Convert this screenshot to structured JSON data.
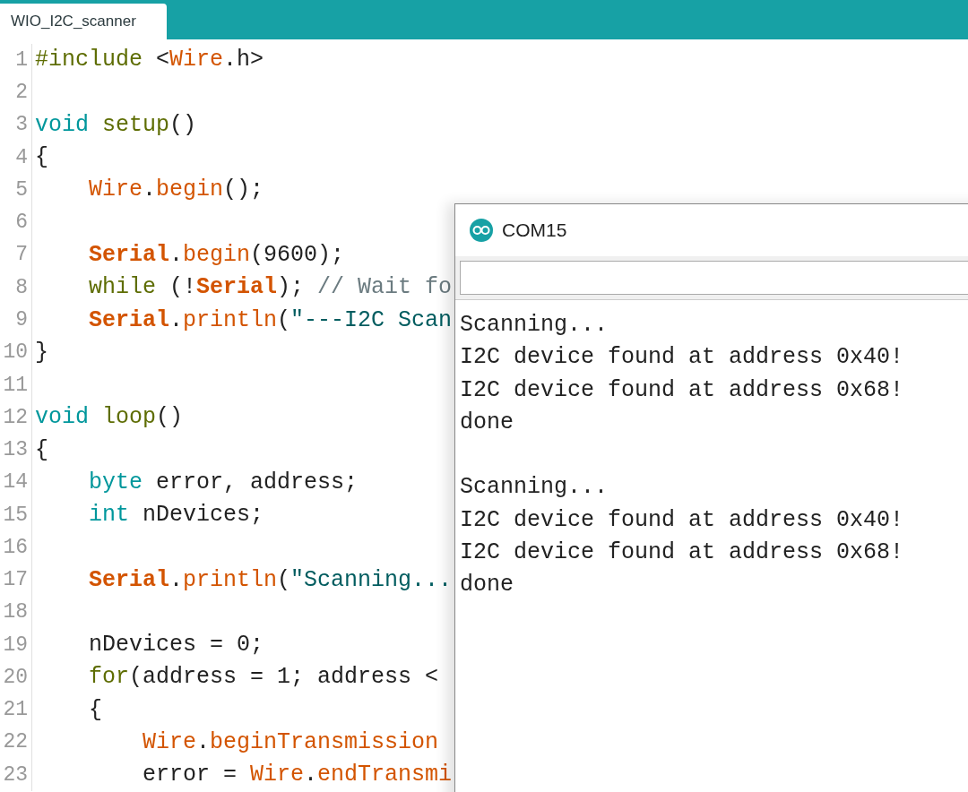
{
  "tabs": [
    {
      "label": "WIO_I2C_scanner",
      "selected": true
    }
  ],
  "editor": {
    "lines": [
      {
        "number": "1",
        "tokens": [
          {
            "text": "#include",
            "kind": "function"
          },
          {
            "text": " <",
            "kind": "plain"
          },
          {
            "text": "Wire",
            "kind": "method"
          },
          {
            "text": ".h>",
            "kind": "plain"
          }
        ]
      },
      {
        "number": "2"
      },
      {
        "number": "3",
        "tokens": [
          {
            "text": "void",
            "kind": "keyword"
          },
          {
            "text": " setup",
            "kind": "function"
          },
          {
            "text": "()",
            "kind": "plain"
          }
        ]
      },
      {
        "number": "4",
        "tokens": [
          {
            "text": "{",
            "kind": "plain"
          }
        ]
      },
      {
        "number": "5",
        "tokens": [
          {
            "text": "    Wire",
            "kind": "method"
          },
          {
            "text": ".",
            "kind": "plain"
          },
          {
            "text": "begin",
            "kind": "method"
          },
          {
            "text": "();",
            "kind": "plain"
          }
        ]
      },
      {
        "number": "6"
      },
      {
        "number": "7",
        "tokens": [
          {
            "text": "    Serial",
            "kind": "class"
          },
          {
            "text": ".",
            "kind": "plain"
          },
          {
            "text": "begin",
            "kind": "method"
          },
          {
            "text": "(9600);",
            "kind": "plain"
          }
        ]
      },
      {
        "number": "8",
        "tokens": [
          {
            "text": "    while",
            "kind": "function"
          },
          {
            "text": " (!",
            "kind": "plain"
          },
          {
            "text": "Serial",
            "kind": "class"
          },
          {
            "text": "); ",
            "kind": "plain"
          },
          {
            "text": "// Wait fo",
            "kind": "comment"
          }
        ]
      },
      {
        "number": "9",
        "tokens": [
          {
            "text": "    Serial",
            "kind": "class"
          },
          {
            "text": ".",
            "kind": "plain"
          },
          {
            "text": "println",
            "kind": "method"
          },
          {
            "text": "(",
            "kind": "plain"
          },
          {
            "text": "\"---I2C Scan",
            "kind": "string"
          }
        ]
      },
      {
        "number": "10",
        "tokens": [
          {
            "text": "}",
            "kind": "plain"
          }
        ]
      },
      {
        "number": "11"
      },
      {
        "number": "12",
        "tokens": [
          {
            "text": "void",
            "kind": "keyword"
          },
          {
            "text": " loop",
            "kind": "function"
          },
          {
            "text": "()",
            "kind": "plain"
          }
        ]
      },
      {
        "number": "13",
        "tokens": [
          {
            "text": "{",
            "kind": "plain"
          }
        ]
      },
      {
        "number": "14",
        "tokens": [
          {
            "text": "    byte",
            "kind": "keyword"
          },
          {
            "text": " error, address;",
            "kind": "plain"
          }
        ]
      },
      {
        "number": "15",
        "tokens": [
          {
            "text": "    int",
            "kind": "keyword"
          },
          {
            "text": " nDevices;",
            "kind": "plain"
          }
        ]
      },
      {
        "number": "16"
      },
      {
        "number": "17",
        "tokens": [
          {
            "text": "    Serial",
            "kind": "class"
          },
          {
            "text": ".",
            "kind": "plain"
          },
          {
            "text": "println",
            "kind": "method"
          },
          {
            "text": "(",
            "kind": "plain"
          },
          {
            "text": "\"Scanning...",
            "kind": "string"
          }
        ]
      },
      {
        "number": "18"
      },
      {
        "number": "19",
        "tokens": [
          {
            "text": "    nDevices = 0;",
            "kind": "plain"
          }
        ]
      },
      {
        "number": "20",
        "tokens": [
          {
            "text": "    for",
            "kind": "function"
          },
          {
            "text": "(address = 1; address <",
            "kind": "plain"
          }
        ]
      },
      {
        "number": "21",
        "tokens": [
          {
            "text": "    {",
            "kind": "plain"
          }
        ]
      },
      {
        "number": "22",
        "tokens": [
          {
            "text": "        Wire",
            "kind": "method"
          },
          {
            "text": ".",
            "kind": "plain"
          },
          {
            "text": "beginTransmission",
            "kind": "method"
          }
        ]
      },
      {
        "number": "23",
        "tokens": [
          {
            "text": "        error = ",
            "kind": "plain"
          },
          {
            "text": "Wire",
            "kind": "method"
          },
          {
            "text": ".",
            "kind": "plain"
          },
          {
            "text": "endTransmi",
            "kind": "method"
          }
        ]
      }
    ]
  },
  "serial_monitor": {
    "title": "COM15",
    "output_blocks": [
      [
        "Scanning...",
        "I2C device found at address 0x40!",
        "I2C device found at address 0x68!",
        "done"
      ],
      [
        "Scanning...",
        "I2C device found at address 0x40!",
        "I2C device found at address 0x68!",
        "done"
      ]
    ]
  }
}
